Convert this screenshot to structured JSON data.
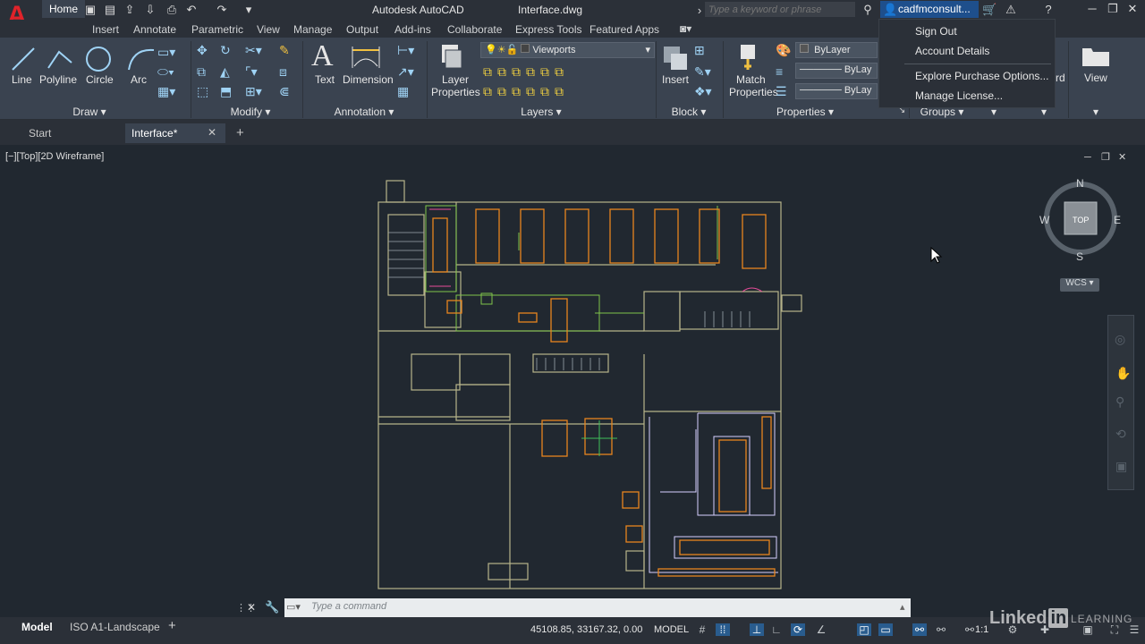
{
  "app": {
    "title": "Autodesk AutoCAD",
    "document": "Interface.dwg",
    "search_placeholder": "Type a keyword or phrase",
    "user": "cadfmconsult...",
    "logo_letter": "A"
  },
  "ribbon_tabs": [
    "Home",
    "Insert",
    "Annotate",
    "Parametric",
    "View",
    "Manage",
    "Output",
    "Add-ins",
    "Collaborate",
    "Express Tools",
    "Featured Apps"
  ],
  "ribbon": {
    "draw": {
      "line": "Line",
      "polyline": "Polyline",
      "circle": "Circle",
      "arc": "Arc",
      "panel": "Draw"
    },
    "modify": {
      "panel": "Modify"
    },
    "annotation": {
      "text": "Text",
      "dimension": "Dimension",
      "panel": "Annotation"
    },
    "layers": {
      "layer_properties_1": "Layer",
      "layer_properties_2": "Properties",
      "current_layer": "Viewports",
      "panel": "Layers"
    },
    "block": {
      "insert": "Insert",
      "panel": "Block"
    },
    "properties": {
      "match_1": "Match",
      "match_2": "Properties",
      "color": "ByLayer",
      "linetype": "ByLay",
      "lineweight": "ByLay",
      "panel": "Properties"
    },
    "groups": {
      "panel": "Groups"
    },
    "view": {
      "label": "View"
    },
    "clipboard_partial": "rd"
  },
  "user_menu": [
    "Sign Out",
    "Account Details",
    "Explore Purchase Options...",
    "Manage License..."
  ],
  "file_tabs": {
    "start": "Start",
    "current": "Interface*"
  },
  "viewport": {
    "label": "[−][Top][2D Wireframe]"
  },
  "viewcube": {
    "n": "N",
    "s": "S",
    "e": "E",
    "w": "W",
    "face": "TOP",
    "wcs": "WCS"
  },
  "command_line": {
    "placeholder": "Type a command"
  },
  "layout_tabs": [
    "Model",
    "ISO A1-Landscape"
  ],
  "status": {
    "coords": "45108.85, 33167.32, 0.00",
    "space": "MODEL",
    "scale": "1:1"
  },
  "watermark": {
    "brand": "Linked",
    "in": "in",
    "sub": "LEARNING"
  },
  "colors": {
    "accent": "#1e4f8c",
    "cad_wall": "#b7b48a",
    "cad_furniture": "#e8851f"
  }
}
